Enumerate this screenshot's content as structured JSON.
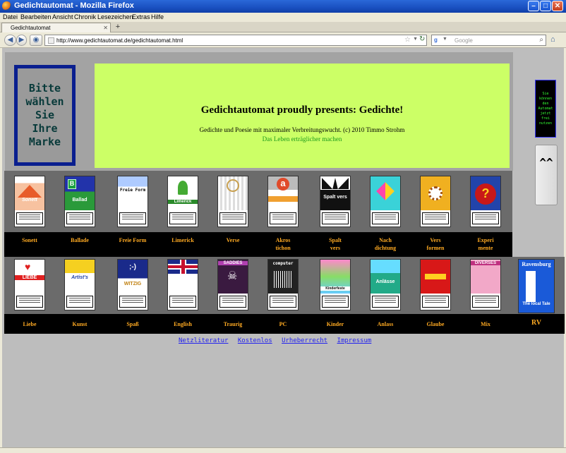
{
  "window": {
    "title": "Gedichtautomat - Mozilla Firefox"
  },
  "menu": [
    "Datei",
    "Bearbeiten",
    "Ansicht",
    "Chronik",
    "Lesezeichen",
    "Extras",
    "Hilfe"
  ],
  "tabs": [
    {
      "label": "Gedichtautomat"
    }
  ],
  "nav": {
    "url": "http://www.gedichtautomat.de/gedichtautomat.html",
    "search_placeholder": "Google"
  },
  "page": {
    "brand_box": "Bitte\nwählen\nSie\nIhre\nMarke",
    "banner": {
      "headline": "Gedichtautomat proudly presents: Gedichte!",
      "subline": "Gedichte und Poesie mit maximaler Verbreitungswucht. (c) 2010 Timmo Strohm",
      "link": "Das Leben erträglicher machen"
    },
    "side_box": "Sie\nkönnen\nden\nAutomat\njetzt\nfrei\nnutzen",
    "up_button": "^^",
    "row1": [
      {
        "label": "Sonett",
        "color": "#e85c2a"
      },
      {
        "label": "Ballade",
        "color": "#1f9a3a"
      },
      {
        "label": "Freie Form",
        "color": "#cfe4ff"
      },
      {
        "label": "Limerick",
        "color": "#ffffff"
      },
      {
        "label": "Verse",
        "color": "#eeeeee"
      },
      {
        "label": "Akros\ntichon",
        "color": "#e04a2a"
      },
      {
        "label": "Spalt\nvers",
        "color": "#111111"
      },
      {
        "label": "Nach\ndichtung",
        "color": "#3ad2d8"
      },
      {
        "label": "Vers\nformen",
        "color": "#f0b020"
      },
      {
        "label": "Experi\nmente",
        "color": "#b01818"
      }
    ],
    "row2": [
      {
        "label": "Liebe",
        "color": "#ffffff"
      },
      {
        "label": "Kunst",
        "color": "#f5d020"
      },
      {
        "label": "Spaß",
        "color": "#1a2a8a"
      },
      {
        "label": "English",
        "color": "#c8102e"
      },
      {
        "label": "Traurig",
        "color": "#3a1a40"
      },
      {
        "label": "PC",
        "color": "#222222"
      },
      {
        "label": "Kinder",
        "color": "#88dd66"
      },
      {
        "label": "Anlass",
        "color": "#22aa88"
      },
      {
        "label": "Glaube",
        "color": "#d81818"
      },
      {
        "label": "Mix",
        "color": "#f2a8c8"
      },
      {
        "label": "RV",
        "color": "#1a5ad8"
      }
    ],
    "pack_texts": {
      "sonett": "Sonett",
      "ballad": "Ballad",
      "freie": "Freie Form",
      "limerick": "Limerick",
      "spalt": "Spalt vers",
      "liebe": "LIEBE",
      "artists": "Artist's",
      "spass": ";-)",
      "witzig": "WITZIG",
      "saddies": "SADDIES",
      "computer": "computer",
      "kinder": "Kinderfeste",
      "anlasse": "Anlässe",
      "diverses": "DIVERSES",
      "ravensburg": "Ravensburg",
      "tale": "The local Tale"
    },
    "footer_links": [
      "Netzliteratur",
      "Kostenlos",
      "Urheberrecht",
      "Impressum"
    ]
  }
}
